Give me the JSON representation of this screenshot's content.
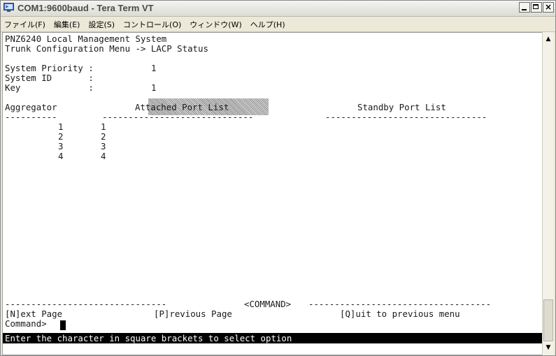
{
  "window": {
    "title": "COM1:9600baud - Tera Term VT",
    "icon": "teraterm-app-icon",
    "buttons": {
      "minimize": "minimize-icon",
      "maximize": "maximize-icon",
      "close": "×"
    }
  },
  "menu": {
    "items": [
      {
        "label": "ファイル(F)"
      },
      {
        "label": "編集(E)"
      },
      {
        "label": "設定(S)"
      },
      {
        "label": "コントロール(O)"
      },
      {
        "label": "ウィンドウ(W)"
      },
      {
        "label": "ヘルプ(H)"
      }
    ]
  },
  "terminal": {
    "header_title": "PNZ6240 Local Management System",
    "breadcrumb": "Trunk Configuration Menu -> LACP Status",
    "system_priority_label": "System Priority :",
    "system_priority_value": "1",
    "system_id_label": "System ID       :",
    "key_label": "Key             :",
    "key_value": "1",
    "columns": {
      "aggregator": "Aggregator",
      "attached_ports": "Attached Port List",
      "standby_ports": "Standby Port List"
    },
    "rows": [
      {
        "aggregator": "1",
        "attached": "1",
        "standby": ""
      },
      {
        "aggregator": "2",
        "attached": "2",
        "standby": ""
      },
      {
        "aggregator": "3",
        "attached": "3",
        "standby": ""
      },
      {
        "aggregator": "4",
        "attached": "4",
        "standby": ""
      }
    ],
    "command_separator_label": "<COMMAND>",
    "commands": {
      "next_page": "[N]ext Page",
      "previous_page": "[P]revious Page",
      "quit": "[Q]uit to previous menu"
    },
    "prompt": "Command>",
    "status_message": "Enter the character in square brackets to select option"
  },
  "scrollbar": {
    "up_icon": "▲",
    "down_icon": "▼"
  },
  "colors": {
    "status_bar_bg": "#000000",
    "status_bar_fg": "#ffffff",
    "terminal_bg": "#ffffff",
    "terminal_fg": "#1a1a1a",
    "chrome_bg": "#ece9d8"
  }
}
